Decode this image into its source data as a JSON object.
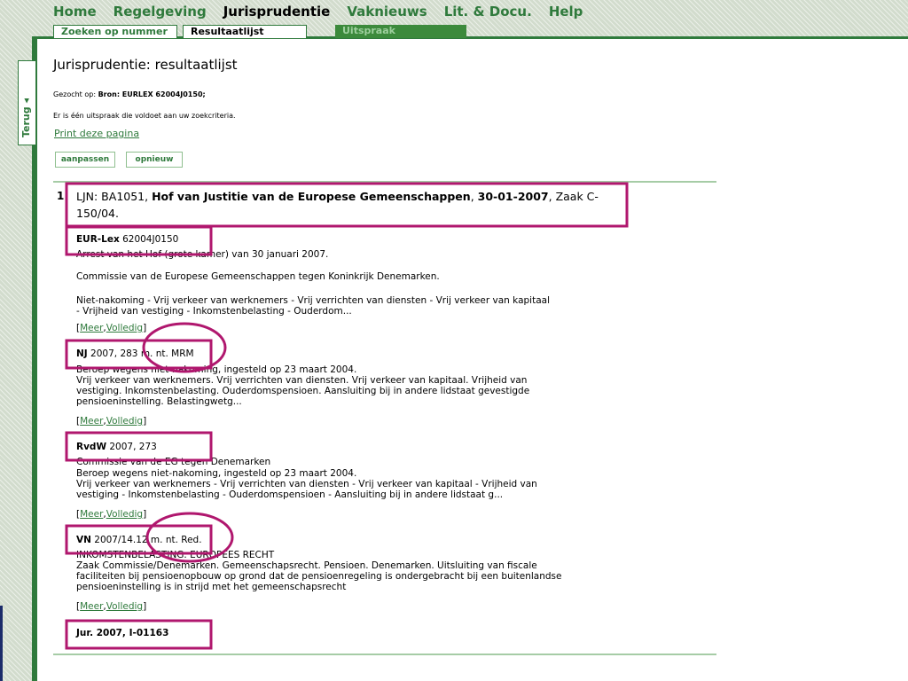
{
  "nav": {
    "items": [
      "Home",
      "Regelgeving",
      "Jurisprudentie",
      "Vaknieuws",
      "Lit. & Docu.",
      "Help"
    ],
    "active": "Jurisprudentie"
  },
  "subtabs": {
    "items": [
      "Zoeken op nummer",
      "Resultaatlijst",
      "Uitspraak"
    ],
    "active": "Resultaatlijst"
  },
  "sidebar": {
    "terug": "Terug ◂"
  },
  "page": {
    "title": "Jurisprudentie: resultaatlijst",
    "gezocht_label": "Gezocht op:",
    "gezocht_value": "Bron: EURLEX 62004J0150;",
    "count_text": "Er is één uitspraak die voldoet aan uw zoekcriteria.",
    "print_link": "Print deze pagina",
    "btn_aanpassen": "aanpassen",
    "btn_opnieuw": "opnieuw"
  },
  "result": {
    "number": "1.",
    "ljn": "LJN: BA1051,",
    "court": "Hof van Justitie van de Europese Gemeenschappen",
    "sep": ",",
    "date": "30-01-2007",
    "zaak": ", Zaak C-150/04.",
    "sources": [
      {
        "name": "EUR-Lex",
        "ref": "62004J0150",
        "lines": [
          "Arrest van het Hof (grote kamer) van 30 januari 2007.",
          "",
          "Commissie van de Europese Gemeenschappen tegen Koninkrijk Denemarken.",
          "",
          "Niet-nakoming - Vrij verkeer van werknemers - Vrij verrichten van diensten - Vrij verkeer van kapitaal",
          "- Vrijheid van vestiging - Inkomstenbelasting - Ouderdom..."
        ]
      },
      {
        "name": "NJ",
        "ref": "2007, 283 m. nt. MRM",
        "lines": [
          "Beroep wegens niet-nakoming, ingesteld op 23 maart 2004.",
          "Vrij verkeer van werknemers. Vrij verrichten van diensten. Vrij verkeer van kapitaal. Vrijheid van",
          "vestiging. Inkomstenbelasting. Ouderdomspensioen. Aansluiting bij in andere lidstaat gevestigde",
          "pensioeninstelling. Belastingwetg..."
        ]
      },
      {
        "name": "RvdW",
        "ref": "2007, 273",
        "lines": [
          "Commissie van de EG tegen Denemarken",
          "Beroep wegens niet-nakoming, ingesteld op 23 maart 2004.",
          "Vrij verkeer van werknemers - Vrij verrichten van diensten - Vrij verkeer van kapitaal - Vrijheid van",
          "vestiging - Inkomstenbelasting - Ouderdomspensioen - Aansluiting bij in andere lidstaat g..."
        ]
      },
      {
        "name": "VN",
        "ref": "2007/14.12 m. nt. Red.",
        "lines": [
          "INKOMSTENBELASTING. EUROPEES RECHT",
          "Zaak Commissie/Denemarken. Gemeenschapsrecht. Pensioen. Denemarken. Uitsluiting van fiscale",
          "faciliteiten bij pensioenopbouw op grond dat de pensioenregeling is ondergebracht bij een buitenlandse",
          "pensioeninstelling is in strijd met het gemeenschapsrecht"
        ]
      },
      {
        "name": "Jur. 2007, I-01163",
        "ref": "",
        "lines": []
      }
    ],
    "links": {
      "open": "[",
      "meer": "Meer",
      "comma": ",",
      "volledig": "Volledig",
      "close": "]"
    }
  },
  "colors": {
    "nav_green": "#2f7a3c",
    "annotation": "#b0176e"
  }
}
